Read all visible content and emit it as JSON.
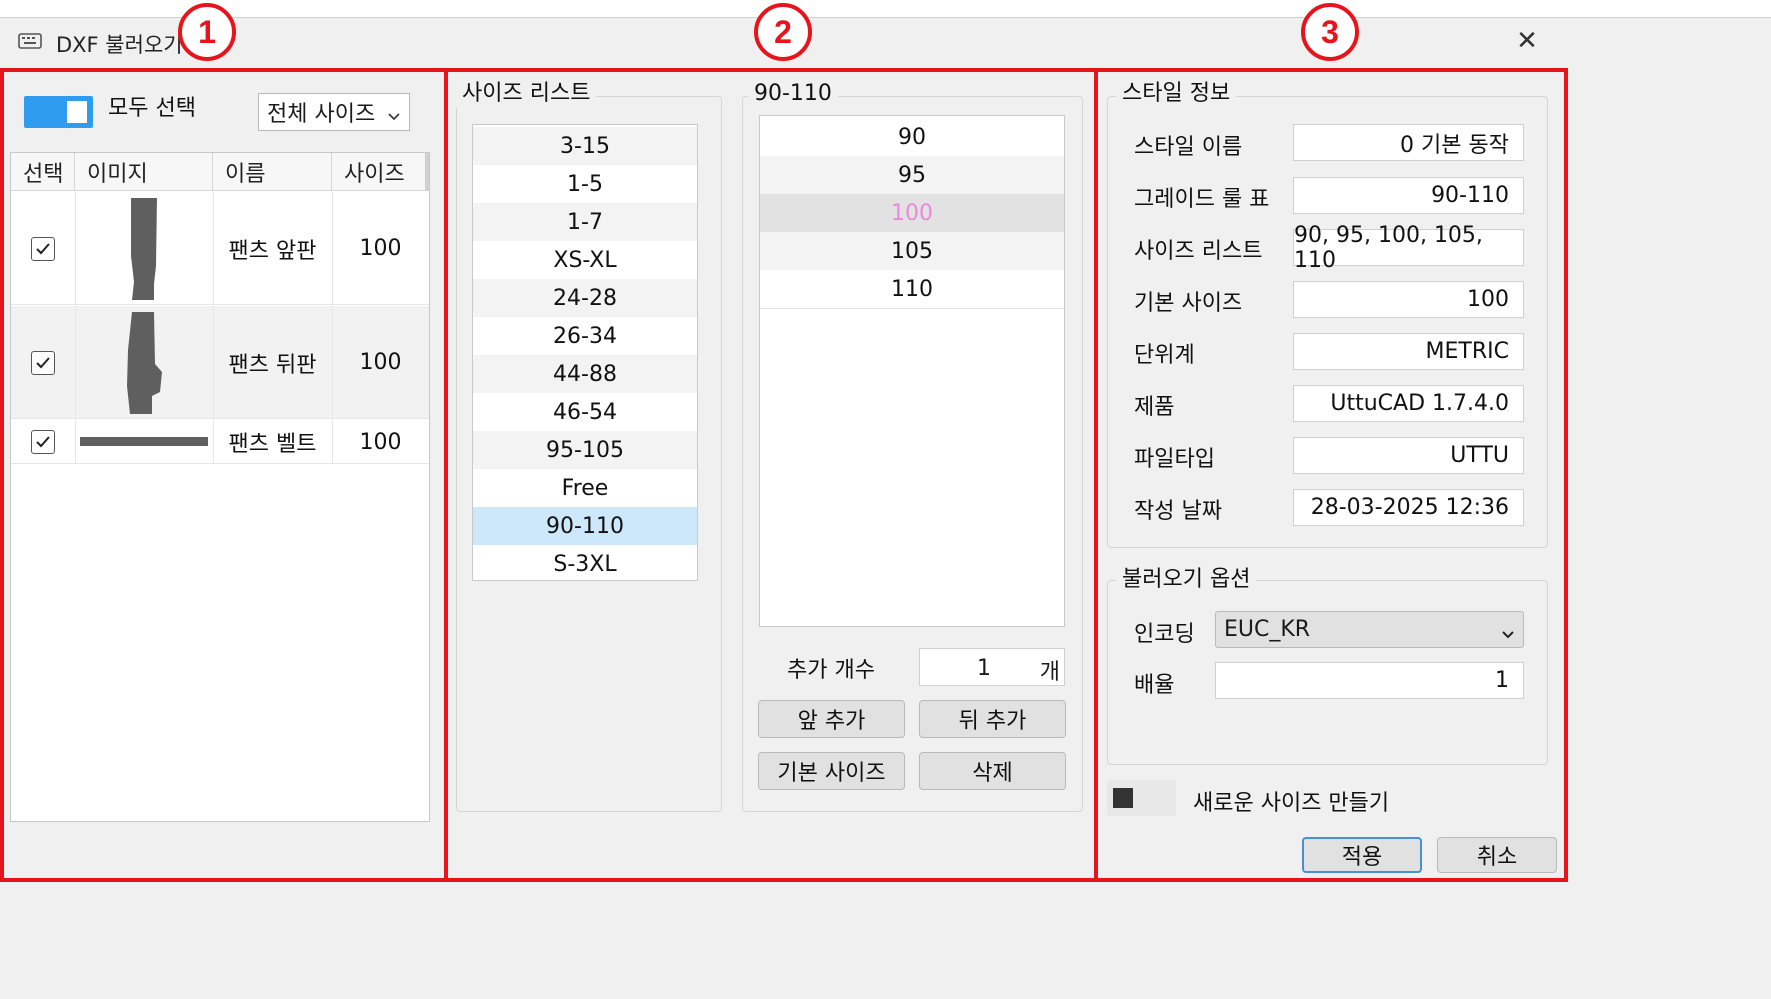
{
  "window": {
    "title": "DXF 불러오기",
    "close_label": "✕"
  },
  "annotations": [
    "1",
    "2",
    "3"
  ],
  "left": {
    "select_all_label": "모두 선택",
    "size_filter": {
      "value": "전체 사이즈",
      "icon": "chevron-down-icon"
    },
    "table": {
      "columns": [
        "선택",
        "이미지",
        "이름",
        "사이즈"
      ],
      "rows": [
        {
          "checked": true,
          "name": "팬츠 앞판",
          "size": "100"
        },
        {
          "checked": true,
          "name": "팬츠 뒤판",
          "size": "100"
        },
        {
          "checked": true,
          "name": "팬츠 벨트",
          "size": "100"
        }
      ]
    }
  },
  "middle": {
    "size_list_title": "사이즈 리스트",
    "size_list": [
      "3-15",
      "1-5",
      "1-7",
      "XS-XL",
      "24-28",
      "26-34",
      "44-88",
      "46-54",
      "95-105",
      "Free",
      "90-110",
      "S-3XL"
    ],
    "selected_size_list": "90-110",
    "detail_title": "90-110",
    "detail_sizes": [
      "90",
      "95",
      "100",
      "105",
      "110"
    ],
    "highlighted_size": "100",
    "add_count_label": "추가 개수",
    "add_count_value": "1",
    "add_count_unit": "개",
    "buttons": {
      "add_front": "앞 추가",
      "add_back": "뒤 추가",
      "base_size": "기본 사이즈",
      "delete": "삭제"
    }
  },
  "right": {
    "style_info_title": "스타일 정보",
    "fields": [
      {
        "label": "스타일 이름",
        "value": "0 기본 동작"
      },
      {
        "label": "그레이드 룰 표",
        "value": "90-110"
      },
      {
        "label": "사이즈 리스트",
        "value": "90, 95, 100, 105, 110"
      },
      {
        "label": "기본 사이즈",
        "value": "100"
      },
      {
        "label": "단위계",
        "value": "METRIC"
      },
      {
        "label": "제품",
        "value": "UttuCAD 1.7.4.0"
      },
      {
        "label": "파일타입",
        "value": "UTTU"
      },
      {
        "label": "작성 날짜",
        "value": "28-03-2025 12:36"
      }
    ],
    "import_options_title": "불러오기 옵션",
    "encoding_label": "인코딩",
    "encoding_value": "EUC_KR",
    "scale_label": "배율",
    "scale_value": "1",
    "new_size_label": "새로운 사이즈 만들기",
    "apply_label": "적용",
    "cancel_label": "취소"
  },
  "colors": {
    "annotation": "#e8141c",
    "toggle": "#2f9cf0",
    "selected_row": "#cce8fa",
    "highlight_text": "#e98ad8"
  }
}
